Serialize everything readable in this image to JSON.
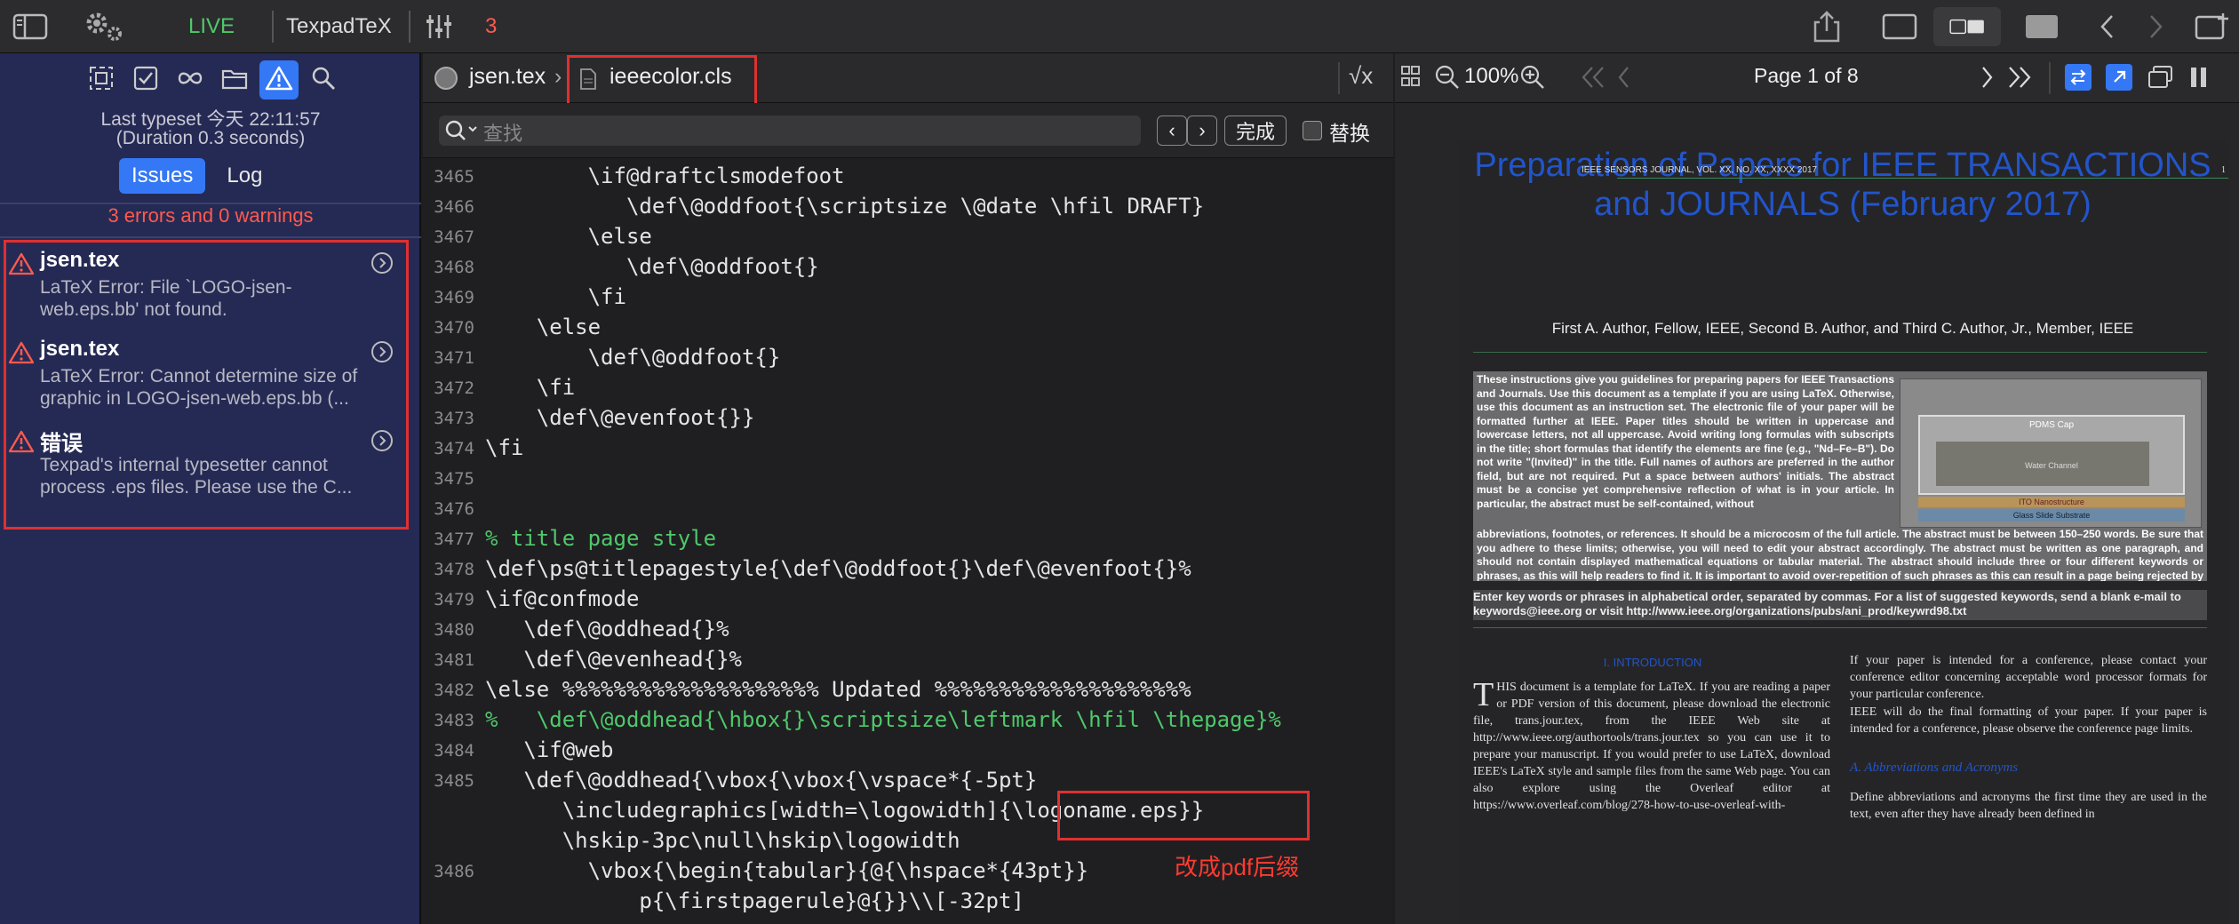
{
  "toolbar": {
    "live_label": "LIVE",
    "engine_label": "TexpadTeX",
    "error_count": "3"
  },
  "sidebar": {
    "last_typeset": "Last typeset 今天 22:11:57",
    "duration": "(Duration 0.3 seconds)",
    "tabs": [
      {
        "label": "Issues"
      },
      {
        "label": "Log"
      }
    ],
    "summary": "3 errors and 0 warnings",
    "issues": [
      {
        "title": "jsen.tex",
        "msg1": "LaTeX Error: File `LOGO-jsen-",
        "msg2": "web.eps.bb' not found."
      },
      {
        "title": "jsen.tex",
        "msg1": "LaTeX Error: Cannot determine size of",
        "msg2": "graphic in LOGO-jsen-web.eps.bb (..."
      },
      {
        "title": "错误",
        "msg1": "Texpad's internal typesetter cannot",
        "msg2": "process .eps files.  Please use the C..."
      }
    ]
  },
  "editor": {
    "crumb_file": "jsen.tex",
    "crumb_sep": "›",
    "active_file": "ieeecolor.cls",
    "search_placeholder": "查找",
    "done_label": "完成",
    "replace_label": "替换",
    "annotation": "改成pdf后缀",
    "lines": [
      {
        "n": "3465",
        "t": "        \\if@draftclsmodefoot"
      },
      {
        "n": "3466",
        "t": "           \\def\\@oddfoot{\\scriptsize \\@date \\hfil DRAFT}"
      },
      {
        "n": "3467",
        "t": "        \\else"
      },
      {
        "n": "3468",
        "t": "           \\def\\@oddfoot{}"
      },
      {
        "n": "3469",
        "t": "        \\fi"
      },
      {
        "n": "3470",
        "t": "    \\else"
      },
      {
        "n": "3471",
        "t": "        \\def\\@oddfoot{}"
      },
      {
        "n": "3472",
        "t": "    \\fi"
      },
      {
        "n": "3473",
        "t": "    \\def\\@evenfoot{}}"
      },
      {
        "n": "3474",
        "t": "\\fi"
      },
      {
        "n": "3475",
        "t": ""
      },
      {
        "n": "3476",
        "t": ""
      },
      {
        "n": "3477",
        "t": "% title page style"
      },
      {
        "n": "3478",
        "t": "\\def\\ps@titlepagestyle{\\def\\@oddfoot{}\\def\\@evenfoot{}%"
      },
      {
        "n": "3479",
        "t": "\\if@confmode"
      },
      {
        "n": "3480",
        "t": "   \\def\\@oddhead{}%"
      },
      {
        "n": "3481",
        "t": "   \\def\\@evenhead{}%"
      },
      {
        "n": "3482",
        "t": "\\else %%%%%%%%%%%%%%%%%%%% Updated %%%%%%%%%%%%%%%%%%%%"
      },
      {
        "n": "3483",
        "t": "%   \\def\\@oddhead{\\hbox{}\\scriptsize\\leftmark \\hfil \\thepage}%"
      },
      {
        "n": "3484",
        "t": "   \\if@web"
      },
      {
        "n": "3485",
        "t": "   \\def\\@oddhead{\\vbox{\\vbox{\\vspace*{-5pt}"
      },
      {
        "n": "",
        "t": "      \\includegraphics[width=\\logowidth]{\\logoname.eps}}"
      },
      {
        "n": "",
        "t": "      \\hskip-3pc\\null\\hskip\\logowidth"
      },
      {
        "n": "3486",
        "t": "        \\vbox{\\begin{tabular}{@{\\hspace*{43pt}}"
      },
      {
        "n": "",
        "t": "            p{\\firstpagerule}@{}}\\\\[-32pt]"
      }
    ]
  },
  "preview": {
    "zoom": "100%",
    "page_label": "Page 1 of 8",
    "header_line": "IEEE SENSORS JOURNAL, VOL. XX, NO. XX, XXXX 2017",
    "header_page": "1",
    "title": "Preparation of Papers for IEEE TRANSACTIONS and JOURNALS (February 2017)",
    "authors": "First A. Author, Fellow, IEEE, Second B. Author, and Third C. Author, Jr., Member, IEEE",
    "abstract_intro": "These instructions give you guidelines for preparing papers for IEEE Transactions and Journals. Use this document as a template if you are using LaTeX. Otherwise, use this document as an instruction set. The electronic file of your paper will be formatted further at IEEE. Paper titles should be written in uppercase and lowercase letters, not all uppercase. Avoid writing long formulas with subscripts in the title; short formulas that identify the elements are fine (e.g., \"Nd–Fe–B\"). Do not write \"(Invited)\" in the title. Full names of authors are preferred in the author field, but are not required. Put a space between authors' initials. The abstract must be a concise yet comprehensive reflection of what is in your article. In particular, the abstract must be self-contained, without",
    "abstract_rest": "abbreviations, footnotes, or references. It should be a microcosm of the full article. The abstract must be between 150–250 words. Be sure that you adhere to these limits; otherwise, you will need to edit your abstract accordingly. The abstract must be written as one paragraph, and should not contain displayed mathematical equations or tabular material. The abstract should include three or four different keywords or phrases, as this will help readers to find it. It is important to avoid over-repetition of such phrases as this can result in a page being rejected by search engines. Ensure that your abstract reads well and is grammatically correct.",
    "index_terms": "Enter key words or phrases in alphabetical order, separated by commas. For a list of suggested keywords, send a blank e-mail to keywords@ieee.org or visit http://www.ieee.org/organizations/pubs/ani_prod/keywrd98.txt",
    "fig_labels": [
      "PDMS Cap",
      "Water Channel",
      "ITO Nanostructure",
      "Glass Slide Substrate"
    ],
    "intro_heading": "I. INTRODUCTION",
    "intro_text": "HIS document is a template for LaTeX. If you are reading a paper or PDF version of this document, please download the electronic file, trans.jour.tex, from the IEEE Web site at http://www.ieee.org/authortools/trans.jour.tex so you can use it to prepare your manuscript. If you would prefer to use LaTeX, download IEEE's LaTeX style and sample files from the same Web page. You can also explore using the Overleaf editor at https://www.overleaf.com/blog/278-how-to-use-overleaf-with-",
    "right_col1": "If your paper is intended for a conference, please contact your conference editor concerning acceptable word processor formats for your particular conference.",
    "right_col2": "IEEE will do the final formatting of your paper. If your paper is intended for a conference, please observe the conference page limits.",
    "sub_heading": "A. Abbreviations and Acronyms",
    "right_col3": "Define abbreviations and acronyms the first time they are used in the text, even after they have already been defined in"
  },
  "colors": {
    "accent": "#3478f6",
    "error": "#ff5a4e",
    "live": "#4fc96a",
    "sidebar": "#252a54"
  }
}
